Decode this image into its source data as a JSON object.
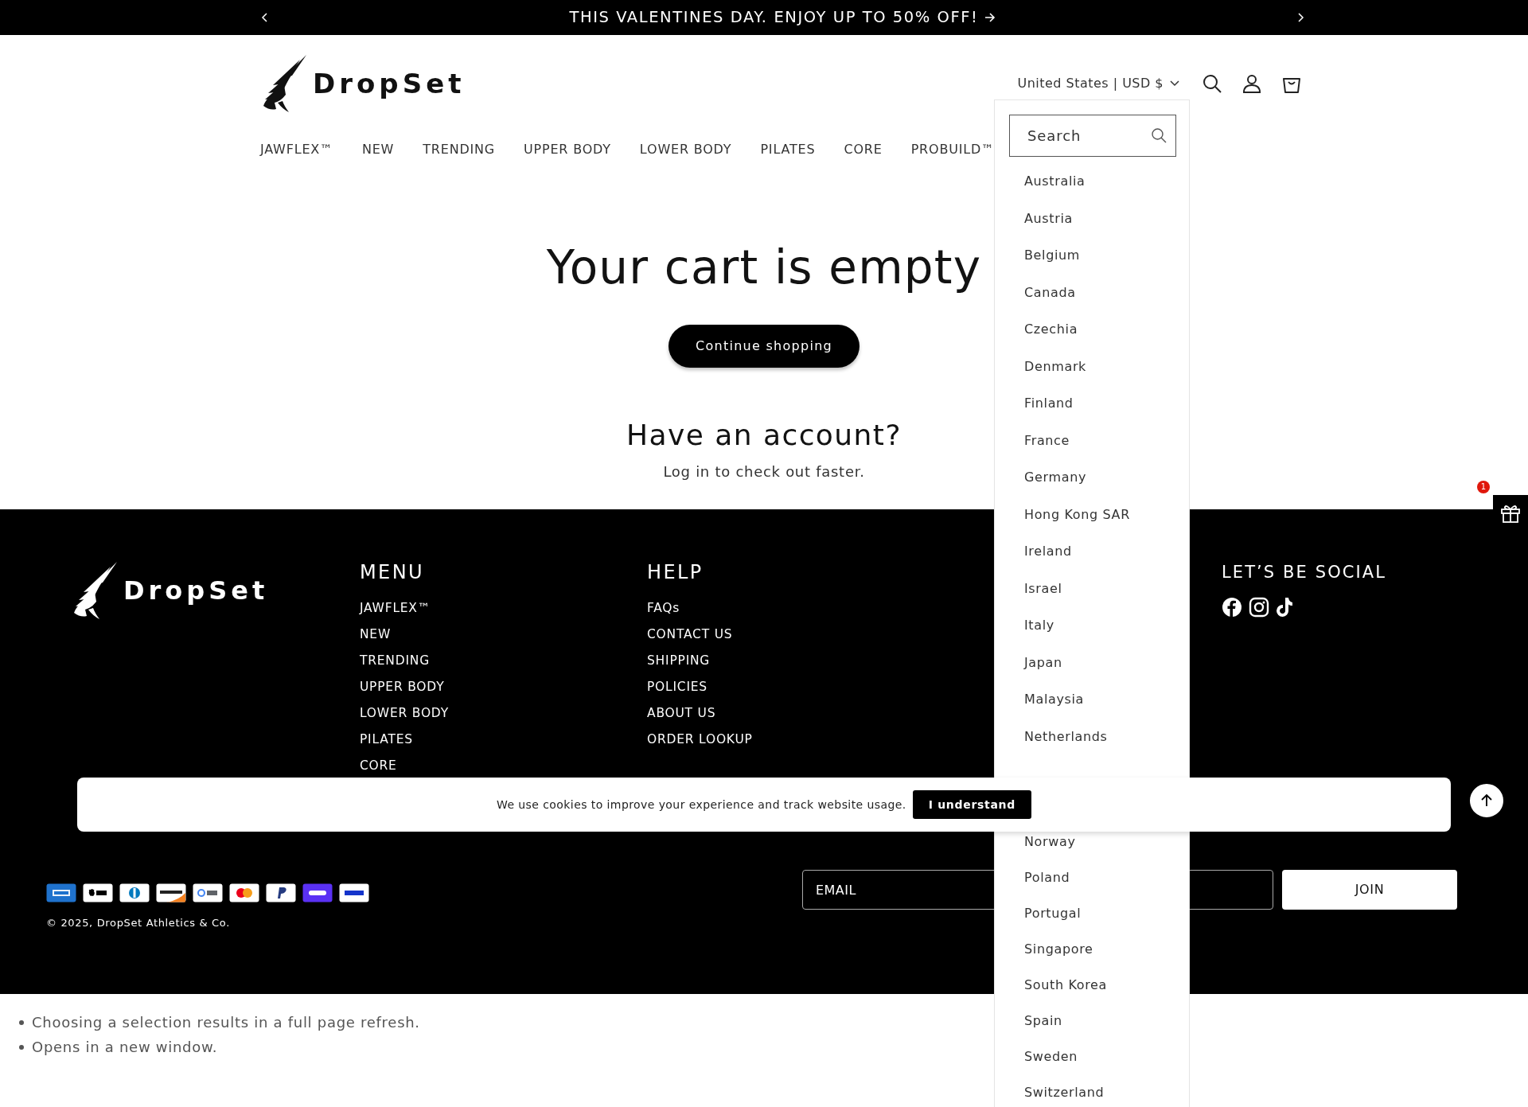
{
  "announcement": {
    "text": "THIS VALENTINES DAY. ENJOY UP TO 50% OFF!"
  },
  "header": {
    "logo": "DropSet",
    "localization": "United States | USD $"
  },
  "nav": [
    "JAWFLEX™",
    "NEW",
    "TRENDING",
    "UPPER BODY",
    "LOWER BODY",
    "PILATES",
    "CORE",
    "PROBUILD™"
  ],
  "cart": {
    "title": "Your cart is empty",
    "button": "Continue shopping",
    "account_heading": "Have an account?",
    "login_link": "Log in",
    "login_rest": " to check out faster."
  },
  "country_dropdown": {
    "search_placeholder": "Search",
    "countries": [
      "Australia",
      "Austria",
      "Belgium",
      "Canada",
      "Czechia",
      "Denmark",
      "Finland",
      "France",
      "Germany",
      "Hong Kong SAR",
      "Ireland",
      "Israel",
      "Italy",
      "Japan",
      "Malaysia",
      "Netherlands"
    ],
    "countries_below_banner": [
      "Norway",
      "Poland",
      "Portugal",
      "Singapore",
      "South Korea",
      "Spain",
      "Sweden",
      "Switzerland"
    ]
  },
  "footer": {
    "logo": "DropSet",
    "menu": {
      "heading": "MENU",
      "links": [
        "JAWFLEX™",
        "NEW",
        "TRENDING",
        "UPPER BODY",
        "LOWER BODY",
        "PILATES",
        "CORE"
      ]
    },
    "help": {
      "heading": "HELP",
      "links": [
        "FAQs",
        "CONTACT US",
        "SHIPPING",
        "POLICIES",
        "ABOUT US",
        "ORDER LOOKUP"
      ]
    },
    "social": {
      "heading": "LET’S BE SOCIAL"
    },
    "copyright": "© 2025, DropSet Athletics & Co.",
    "newsletter": {
      "placeholder": "EMAIL",
      "button": "JOIN"
    }
  },
  "cookie_banner": {
    "text": "We use cookies to improve your experience and track website usage.",
    "button": "I understand"
  },
  "gift_badge": {
    "count": "1"
  },
  "notes": [
    "Choosing a selection results in a full page refresh.",
    "Opens in a new window."
  ]
}
